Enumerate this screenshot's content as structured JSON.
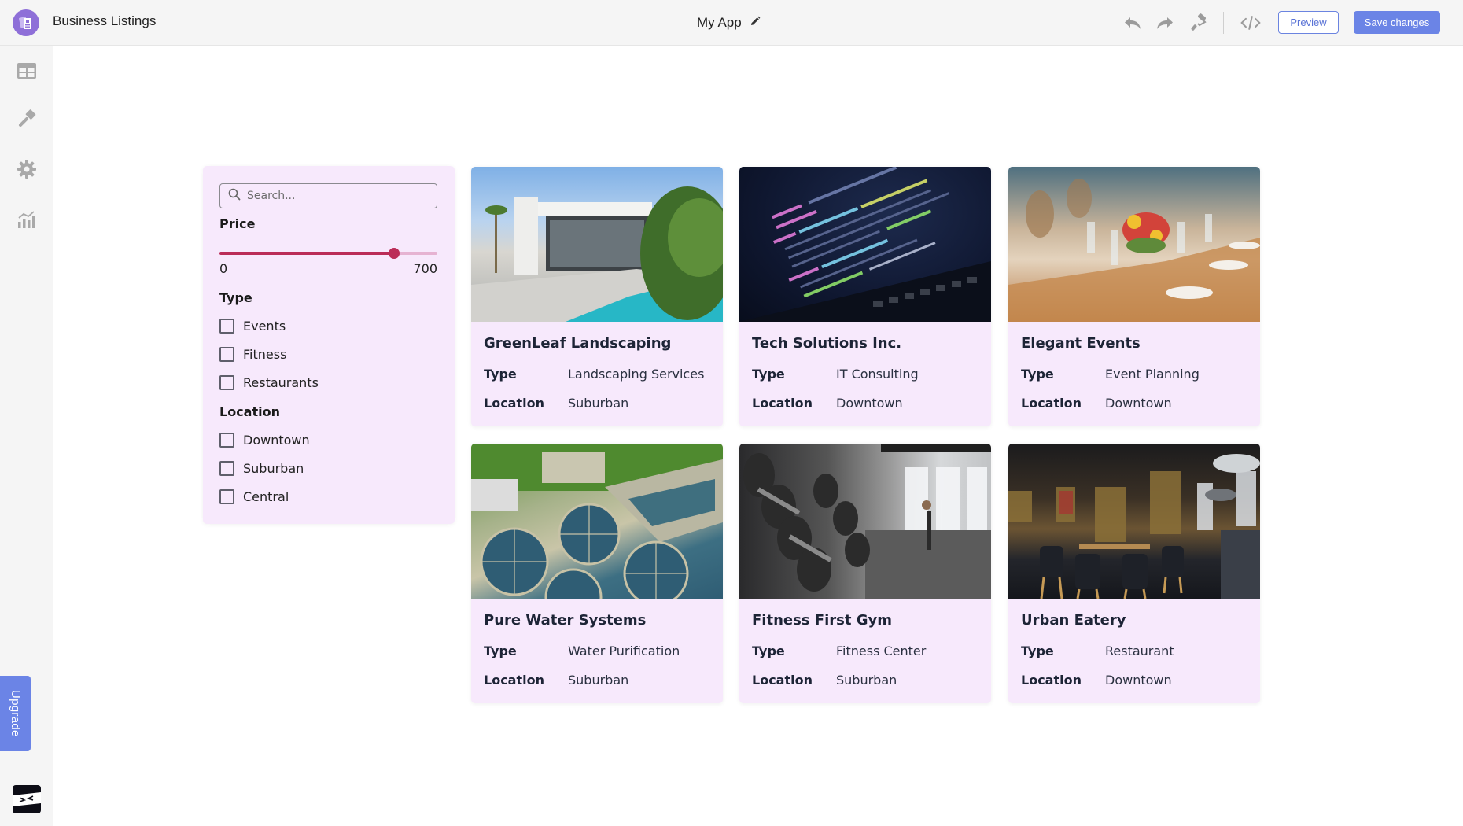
{
  "header": {
    "app_title": "Business Listings",
    "center_title": "My App",
    "icons": {
      "logo": "business-card-icon",
      "edit": "pencil-icon",
      "undo": "undo-icon",
      "redo": "redo-icon",
      "theme": "paint-roller-icon",
      "code": "code-icon"
    },
    "preview_label": "Preview",
    "save_label": "Save changes"
  },
  "sidebar": {
    "items": [
      {
        "name": "table",
        "icon": "table-icon"
      },
      {
        "name": "design",
        "icon": "paintbrush-icon"
      },
      {
        "name": "settings",
        "icon": "gear-icon"
      },
      {
        "name": "analytics",
        "icon": "chart-icon"
      }
    ],
    "upgrade_label": "Upgrade"
  },
  "filters": {
    "search_placeholder": "Search...",
    "search_value": "",
    "price_label": "Price",
    "price_min": "0",
    "price_max": "700",
    "price_slider_fraction": 0.8,
    "type_label": "Type",
    "type_options": [
      {
        "label": "Events",
        "checked": false
      },
      {
        "label": "Fitness",
        "checked": false
      },
      {
        "label": "Restaurants",
        "checked": false
      }
    ],
    "location_label": "Location",
    "location_options": [
      {
        "label": "Downtown",
        "checked": false
      },
      {
        "label": "Suburban",
        "checked": false
      },
      {
        "label": "Central",
        "checked": false
      }
    ]
  },
  "listings": {
    "type_key": "Type",
    "location_key": "Location",
    "items": [
      {
        "name": "GreenLeaf Landscaping",
        "type": "Landscaping Services",
        "location": "Suburban",
        "image": "modern white house with pool and plants"
      },
      {
        "name": "Tech Solutions Inc.",
        "type": "IT Consulting",
        "location": "Downtown",
        "image": "laptop with code on screen"
      },
      {
        "name": "Elegant Events",
        "type": "Event Planning",
        "location": "Downtown",
        "image": "banquet table with flowers and glasses"
      },
      {
        "name": "Pure Water Systems",
        "type": "Water Purification",
        "location": "Suburban",
        "image": "aerial view of water treatment plant"
      },
      {
        "name": "Fitness First Gym",
        "type": "Fitness Center",
        "location": "Suburban",
        "image": "gym with dumbbell racks"
      },
      {
        "name": "Urban Eatery",
        "type": "Restaurant",
        "location": "Downtown",
        "image": "dark modern restaurant interior"
      }
    ]
  },
  "colors": {
    "accent": "#6b84e6",
    "slider": "#bb2d58",
    "panel_bg": "#f7e9fc",
    "logo_purple": "#8e6fd8"
  }
}
